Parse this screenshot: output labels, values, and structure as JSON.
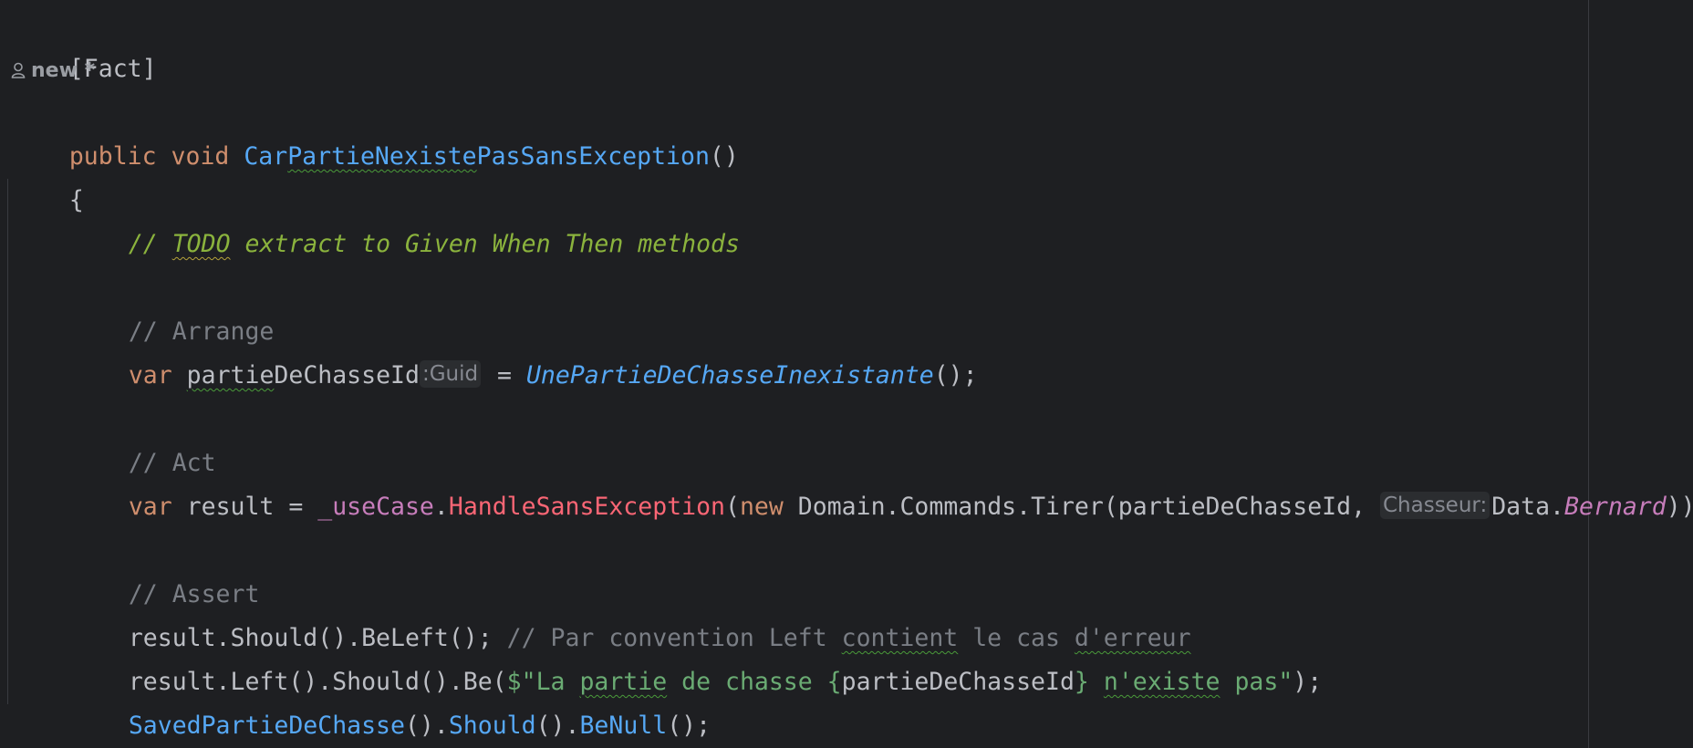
{
  "editor": {
    "attribute": "[Fact]",
    "usage_label": "new *",
    "signature": {
      "keyword_public": "public",
      "keyword_void": "void",
      "method_name_prefix": "Car",
      "method_name_squiggled": "PartieNexiste",
      "method_name_suffix": "PasSansException",
      "parens": "()"
    },
    "open_brace": "{",
    "close_brace": "}",
    "todo_comment": {
      "slashes": "// ",
      "todo_word": "TODO",
      "rest": " extract to Given When Then methods"
    },
    "arrange_comment": "// Arrange",
    "arrange_line": {
      "kw_var": "var",
      "var_name_squiggled": "partie",
      "var_name_rest": "DeChasseId",
      "type_hint": ":Guid",
      "equals": " = ",
      "call": "UnePartieDeChasseInexistante",
      "end": "();"
    },
    "act_comment": "// Act",
    "act_line": {
      "kw_var": "var",
      "result": " result = ",
      "field": "_useCase",
      "dot": ".",
      "method": "HandleSansException",
      "open": "(",
      "kw_new": "new",
      "ctor": " Domain.Commands.Tirer(partieDeChasseId, ",
      "param_hint": "Chasseur:",
      "data_prefix": "Data.",
      "prop": "Bernard",
      "end": "));"
    },
    "assert_comment": "// Assert",
    "assert_line1": {
      "code": "result.Should().BeLeft(); ",
      "comment_a": "// Par convention Left ",
      "comment_sq1": "contient",
      "comment_b": " le cas ",
      "comment_sq2": "d'erreur"
    },
    "assert_line2": {
      "code_a": "result.Left().Should().Be(",
      "str_a": "$\"La ",
      "str_sq1": "partie",
      "str_b": " de chasse ",
      "brace_open": "{",
      "interp": "partieDeChasseId",
      "brace_close": "}",
      "str_c": " ",
      "str_sq2": "n'existe",
      "str_d": " pas\"",
      "code_end": ");"
    },
    "assert_line3": {
      "call1": "SavedPartieDeChasse",
      "p1": "().",
      "call2": "Should",
      "p2": "().",
      "call3": "BeNull",
      "end": "();"
    }
  },
  "colors": {
    "background": "#1e1f22",
    "keyword": "#cf8e6d",
    "method": "#56a8f5",
    "string": "#6aab73",
    "comment": "#7a7e85",
    "todo": "#8bb33d"
  }
}
